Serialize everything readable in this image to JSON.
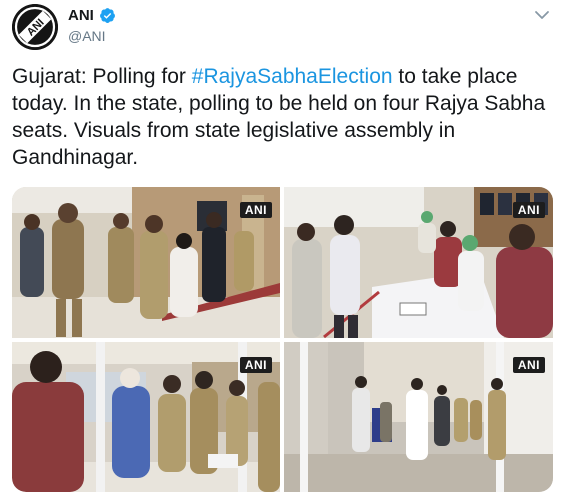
{
  "author": {
    "display_name": "ANI",
    "handle": "@ANI",
    "avatar_text": "ANI",
    "avatar_icon": "ani-logo-icon",
    "verified_icon": "verified-badge-icon"
  },
  "menu_icon": "chevron-down-icon",
  "tweet": {
    "text_before": "Gujarat: Polling for ",
    "hashtag": "#RajyaSabhaElection",
    "text_after": " to take place today. In the state, polling to be held on four Rajya Sabha seats. Visuals from state legislative assembly in Gandhinagar."
  },
  "media": {
    "watermarks": [
      "ANI",
      "ANI",
      "ANI",
      "ANI"
    ]
  },
  "colors": {
    "link": "#1b95e0",
    "verified": "#1da1f2",
    "handle": "#657786"
  }
}
